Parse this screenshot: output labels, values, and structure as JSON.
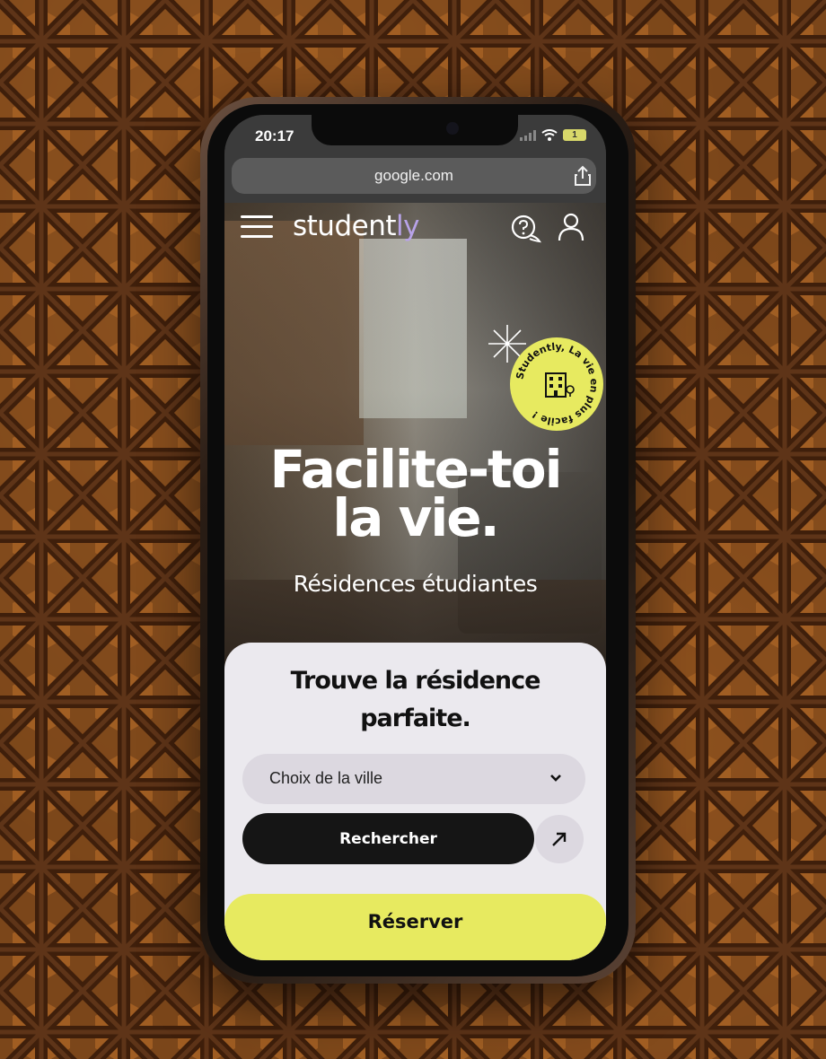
{
  "status_bar": {
    "time": "20:17",
    "battery": "1"
  },
  "browser": {
    "url": "google.com"
  },
  "header": {
    "logo_main": "student",
    "logo_accent": "ly"
  },
  "sticker": {
    "text": "Studently, La vie en plus facile !"
  },
  "hero": {
    "title_line1": "Facilite-toi",
    "title_line2": "la vie.",
    "subtitle": "Résidences étudiantes"
  },
  "search": {
    "title_line1": "Trouve la résidence",
    "title_line2": "parfaite.",
    "city_select": "Choix de la ville",
    "search_button": "Rechercher"
  },
  "reserve_button": "Réserver",
  "colors": {
    "brand_yellow": "#e7ea60",
    "brand_purple": "#b8a3e8",
    "button_dark": "#151515",
    "card_background": "#ebe9ee"
  }
}
